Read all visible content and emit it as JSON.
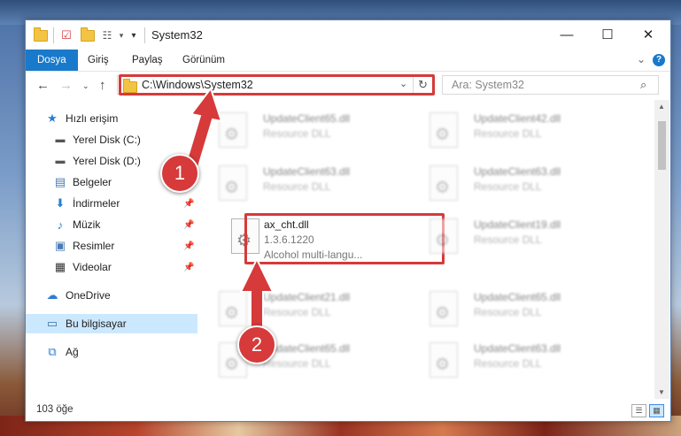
{
  "window": {
    "title": "System32",
    "controls": {
      "minimize": "—",
      "maximize": "☐",
      "close": "✕"
    }
  },
  "ribbon": {
    "tabs": [
      {
        "label": "Dosya"
      },
      {
        "label": "Giriş"
      },
      {
        "label": "Paylaş"
      },
      {
        "label": "Görünüm"
      }
    ],
    "help": "?"
  },
  "address": {
    "path": "C:\\Windows\\System32",
    "search_placeholder": "Ara: System32"
  },
  "sidebar": {
    "items": [
      {
        "label": "Hızlı erişim",
        "icon": "star-icon"
      },
      {
        "label": "Yerel Disk (C:)",
        "icon": "disk-icon"
      },
      {
        "label": "Yerel Disk (D:)",
        "icon": "disk-icon"
      },
      {
        "label": "Belgeler",
        "icon": "document-icon"
      },
      {
        "label": "İndirmeler",
        "icon": "download-icon"
      },
      {
        "label": "Müzik",
        "icon": "music-icon"
      },
      {
        "label": "Resimler",
        "icon": "picture-icon"
      },
      {
        "label": "Videolar",
        "icon": "video-icon"
      },
      {
        "label": "OneDrive",
        "icon": "cloud-icon"
      },
      {
        "label": "Bu bilgisayar",
        "icon": "computer-icon"
      },
      {
        "label": "Ağ",
        "icon": "network-icon"
      }
    ]
  },
  "files": [
    {
      "name": "UpdateClient65.dll",
      "type": "Resource DLL"
    },
    {
      "name": "UpdateClient42.dll",
      "type": "Resource DLL"
    },
    {
      "name": "UpdateClient63.dll",
      "type": "Resource DLL"
    },
    {
      "name": "UpdateClient63.dll",
      "type": "Resource DLL"
    },
    {
      "name": "ax_cht.dll",
      "version": "1.3.6.1220",
      "description": "Alcohol multi-langu..."
    },
    {
      "name": "UpdateClient19.dll",
      "type": "Resource DLL"
    },
    {
      "name": "UpdateClient21.dll",
      "type": "Resource DLL"
    },
    {
      "name": "UpdateClient65.dll",
      "type": "Resource DLL"
    },
    {
      "name": "UpdateClient65.dll",
      "type": "Resource DLL"
    },
    {
      "name": "UpdateClient63.dll",
      "type": "Resource DLL"
    }
  ],
  "status": {
    "count": "103 öğe"
  },
  "annotations": {
    "step1": "1",
    "step2": "2"
  },
  "colors": {
    "highlight": "#d63a3a",
    "accent": "#1979ca",
    "selected": "#cce8ff"
  }
}
